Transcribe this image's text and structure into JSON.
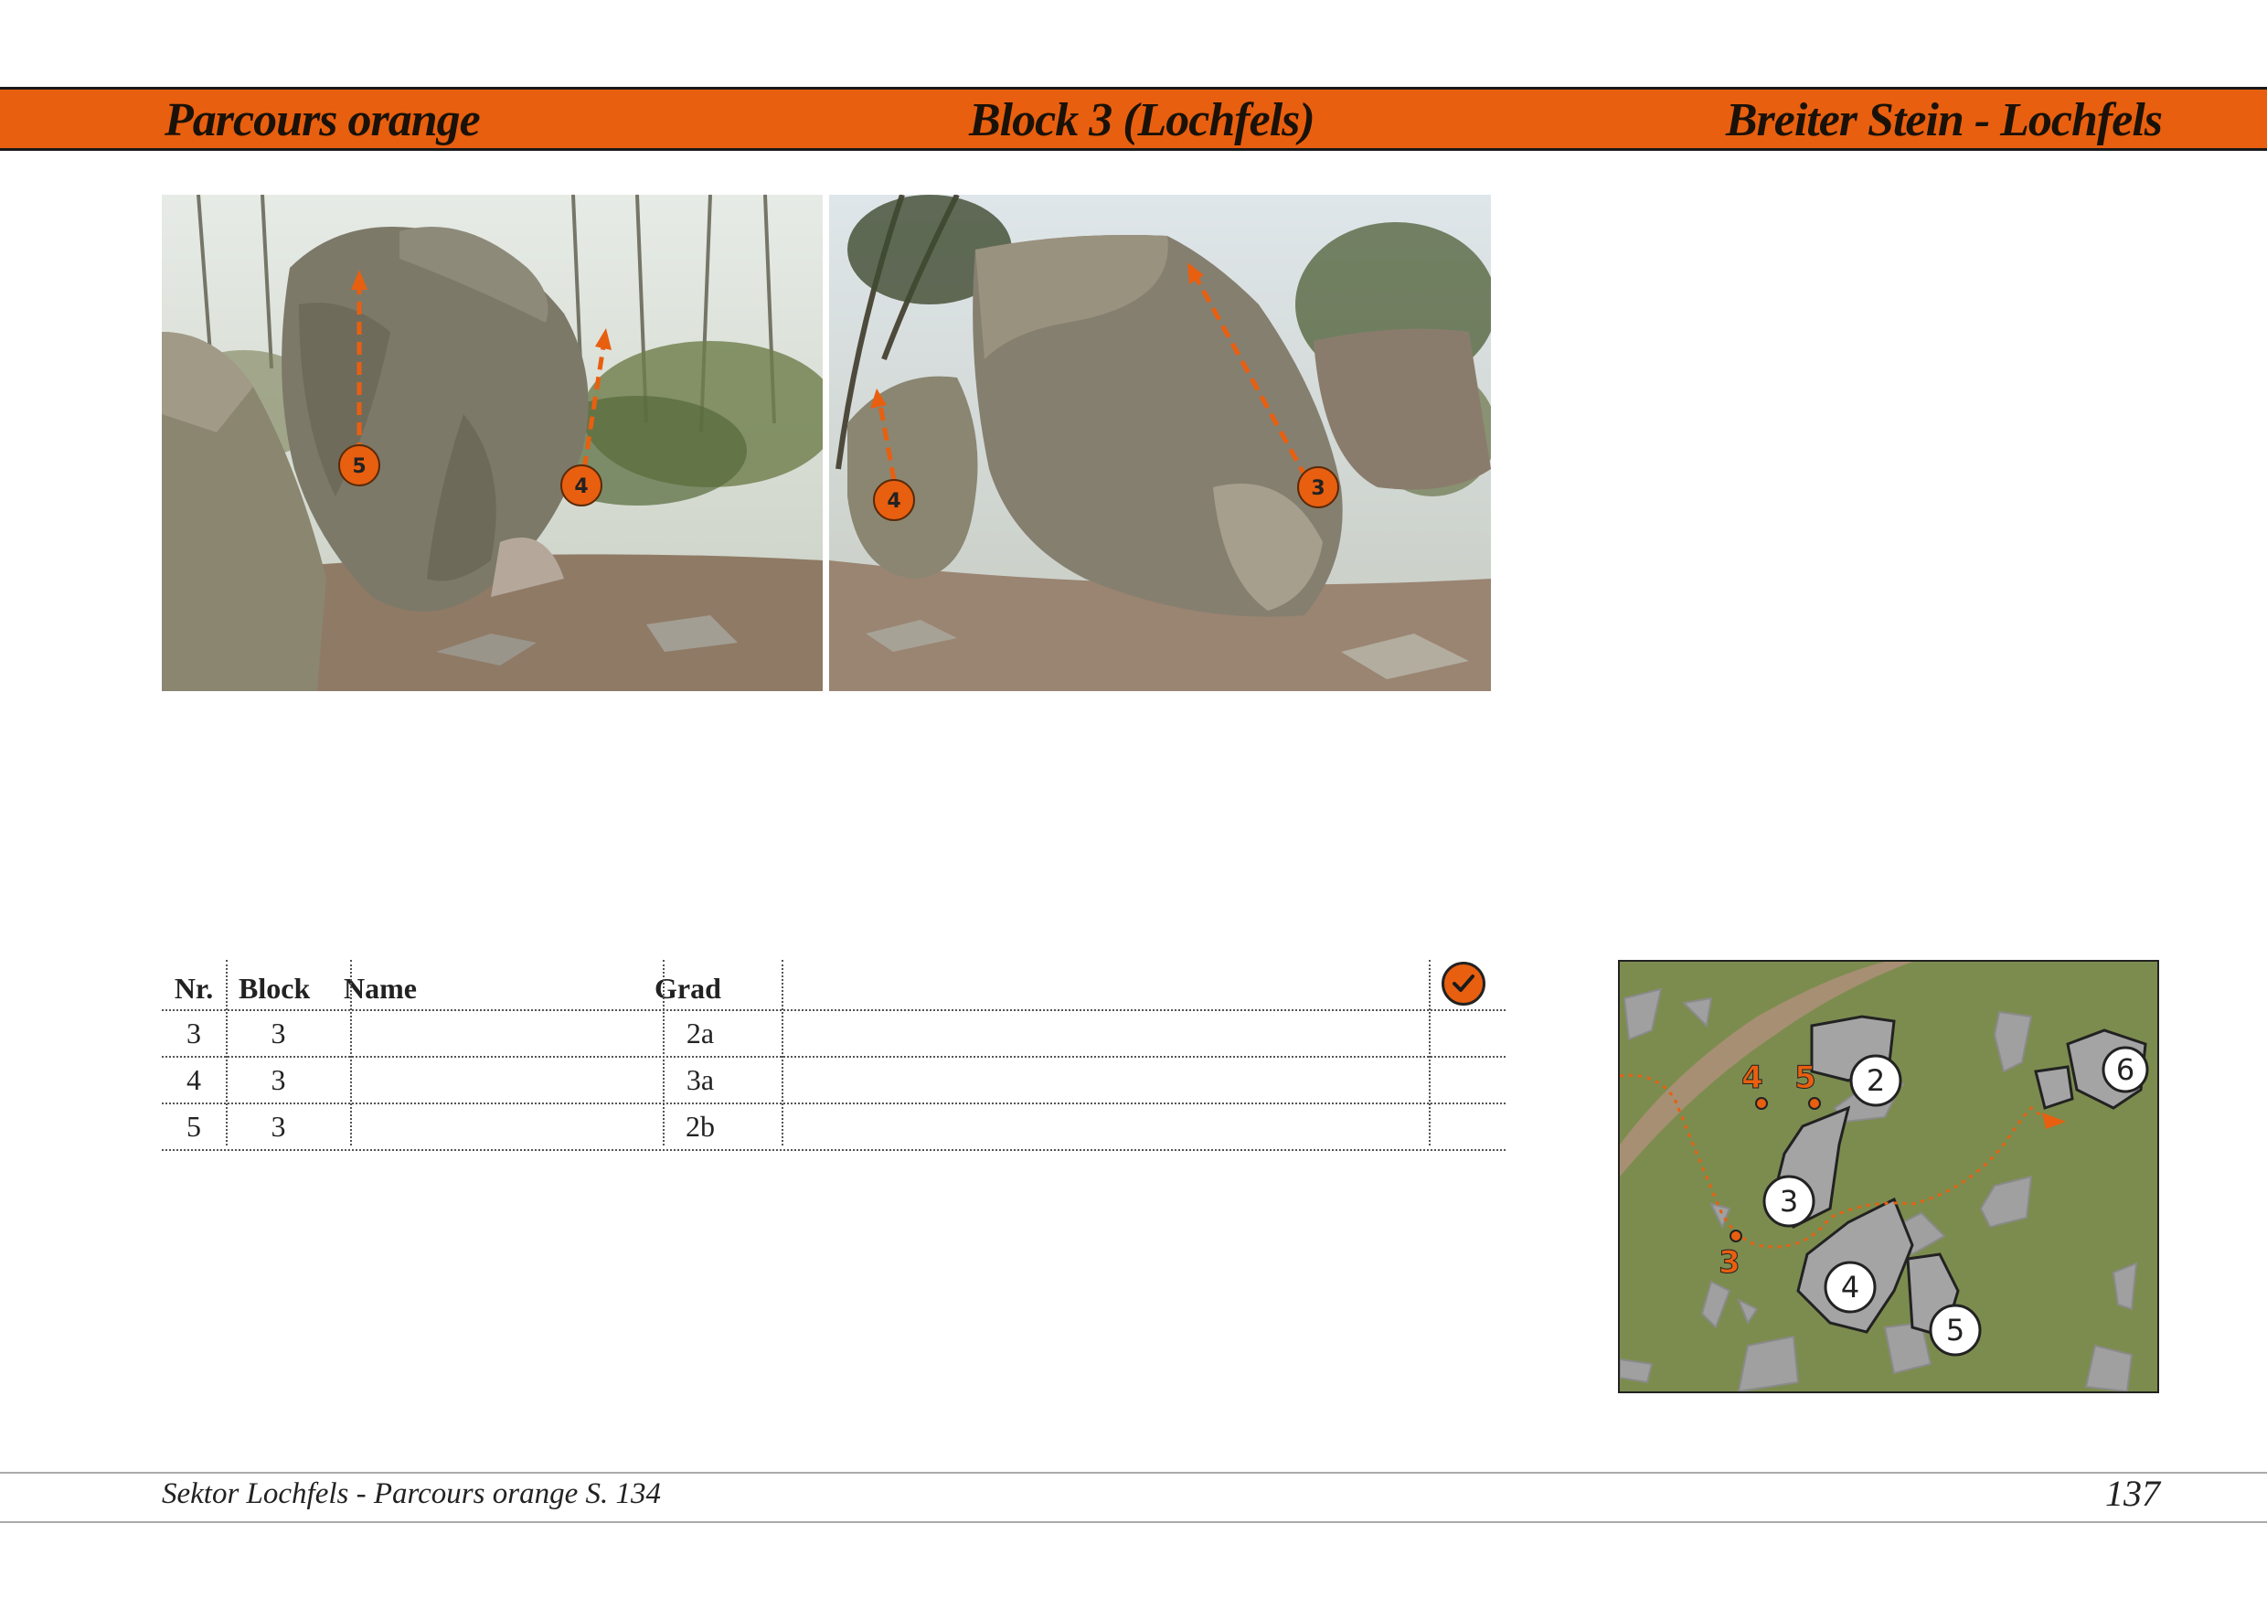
{
  "header": {
    "left": "Parcours orange",
    "center": "Block 3 (Lochfels)",
    "right": "Breiter Stein - Lochfels"
  },
  "photos": {
    "left_routes": [
      "5",
      "4"
    ],
    "right_routes": [
      "4",
      "3"
    ]
  },
  "table": {
    "headers": {
      "nr": "Nr.",
      "block": "Block",
      "name": "Name",
      "grad": "Grad"
    },
    "rows": [
      {
        "nr": "3",
        "block": "3",
        "name": "",
        "grad": "2a"
      },
      {
        "nr": "4",
        "block": "3",
        "name": "",
        "grad": "3a"
      },
      {
        "nr": "5",
        "block": "3",
        "name": "",
        "grad": "2b"
      }
    ]
  },
  "map": {
    "block_labels": [
      "2",
      "3",
      "4",
      "5",
      "6"
    ],
    "route_labels": [
      "4",
      "5",
      "3"
    ]
  },
  "footer": {
    "reference": "Sektor Lochfels - Parcours orange S. 134",
    "page_number": "137"
  },
  "colors": {
    "accent": "#e85f10",
    "map_ground": "#7c8c4e",
    "rock": "#a0a0a0"
  }
}
